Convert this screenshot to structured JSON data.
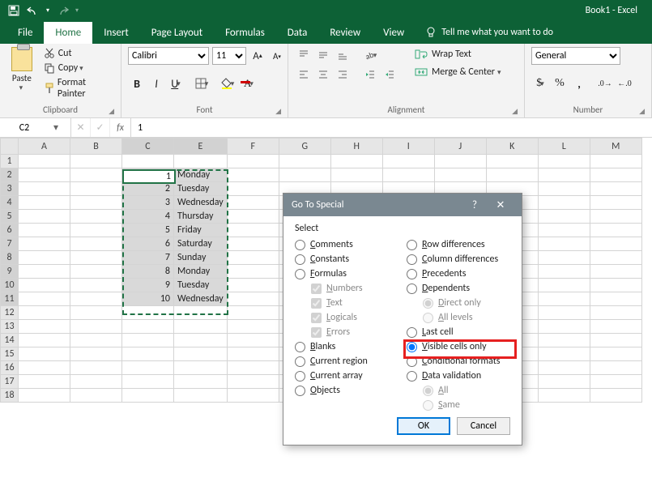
{
  "app": {
    "title": "Book1 - Excel"
  },
  "tabs": [
    "File",
    "Home",
    "Insert",
    "Page Layout",
    "Formulas",
    "Data",
    "Review",
    "View"
  ],
  "active_tab": "Home",
  "tell_me": "Tell me what you want to do",
  "clipboard": {
    "paste": "Paste",
    "cut": "Cut",
    "copy": "Copy",
    "format_painter": "Format Painter",
    "group_label": "Clipboard"
  },
  "font": {
    "name": "Calibri",
    "size": "11",
    "group_label": "Font"
  },
  "alignment": {
    "wrap": "Wrap Text",
    "merge": "Merge & Center",
    "group_label": "Alignment"
  },
  "number": {
    "format": "General",
    "group_label": "Number"
  },
  "formula_bar": {
    "ref": "C2",
    "value": "1"
  },
  "columns": [
    "A",
    "B",
    "C",
    "E",
    "F",
    "G",
    "H",
    "I",
    "J",
    "K",
    "L",
    "M"
  ],
  "rows": [
    {
      "n": 1
    },
    {
      "n": 2,
      "c": "1",
      "e": "Monday"
    },
    {
      "n": 3,
      "c": "2",
      "e": "Tuesday"
    },
    {
      "n": 4,
      "c": "3",
      "e": "Wednesday"
    },
    {
      "n": 5,
      "c": "4",
      "e": "Thursday"
    },
    {
      "n": 6,
      "c": "5",
      "e": "Friday"
    },
    {
      "n": 7,
      "c": "6",
      "e": "Saturday"
    },
    {
      "n": 8,
      "c": "7",
      "e": "Sunday"
    },
    {
      "n": 9,
      "c": "8",
      "e": "Monday"
    },
    {
      "n": 10,
      "c": "9",
      "e": "Tuesday"
    },
    {
      "n": 11,
      "c": "10",
      "e": "Wednesday"
    },
    {
      "n": 12
    },
    {
      "n": 13
    },
    {
      "n": 14
    },
    {
      "n": 15
    },
    {
      "n": 16
    },
    {
      "n": 17
    },
    {
      "n": 18
    }
  ],
  "dialog": {
    "title": "Go To Special",
    "section": "Select",
    "left": [
      {
        "label": "Comments",
        "sub": false
      },
      {
        "label": "Constants",
        "sub": false
      },
      {
        "label": "Formulas",
        "sub": false
      },
      {
        "label": "Numbers",
        "sub": true
      },
      {
        "label": "Text",
        "sub": true
      },
      {
        "label": "Logicals",
        "sub": true
      },
      {
        "label": "Errors",
        "sub": true
      },
      {
        "label": "Blanks",
        "sub": false
      },
      {
        "label": "Current region",
        "sub": false
      },
      {
        "label": "Current array",
        "sub": false
      },
      {
        "label": "Objects",
        "sub": false
      }
    ],
    "right": [
      {
        "label": "Row differences",
        "sub": false
      },
      {
        "label": "Column differences",
        "sub": false
      },
      {
        "label": "Precedents",
        "sub": false
      },
      {
        "label": "Dependents",
        "sub": false
      },
      {
        "label": "Direct only",
        "sub": true
      },
      {
        "label": "All levels",
        "sub": true
      },
      {
        "label": "Last cell",
        "sub": false
      },
      {
        "label": "Visible cells only",
        "sub": false,
        "checked": true
      },
      {
        "label": "Conditional formats",
        "sub": false
      },
      {
        "label": "Data validation",
        "sub": false
      },
      {
        "label": "All",
        "sub": true
      },
      {
        "label": "Same",
        "sub": true
      }
    ],
    "ok": "OK",
    "cancel": "Cancel"
  }
}
